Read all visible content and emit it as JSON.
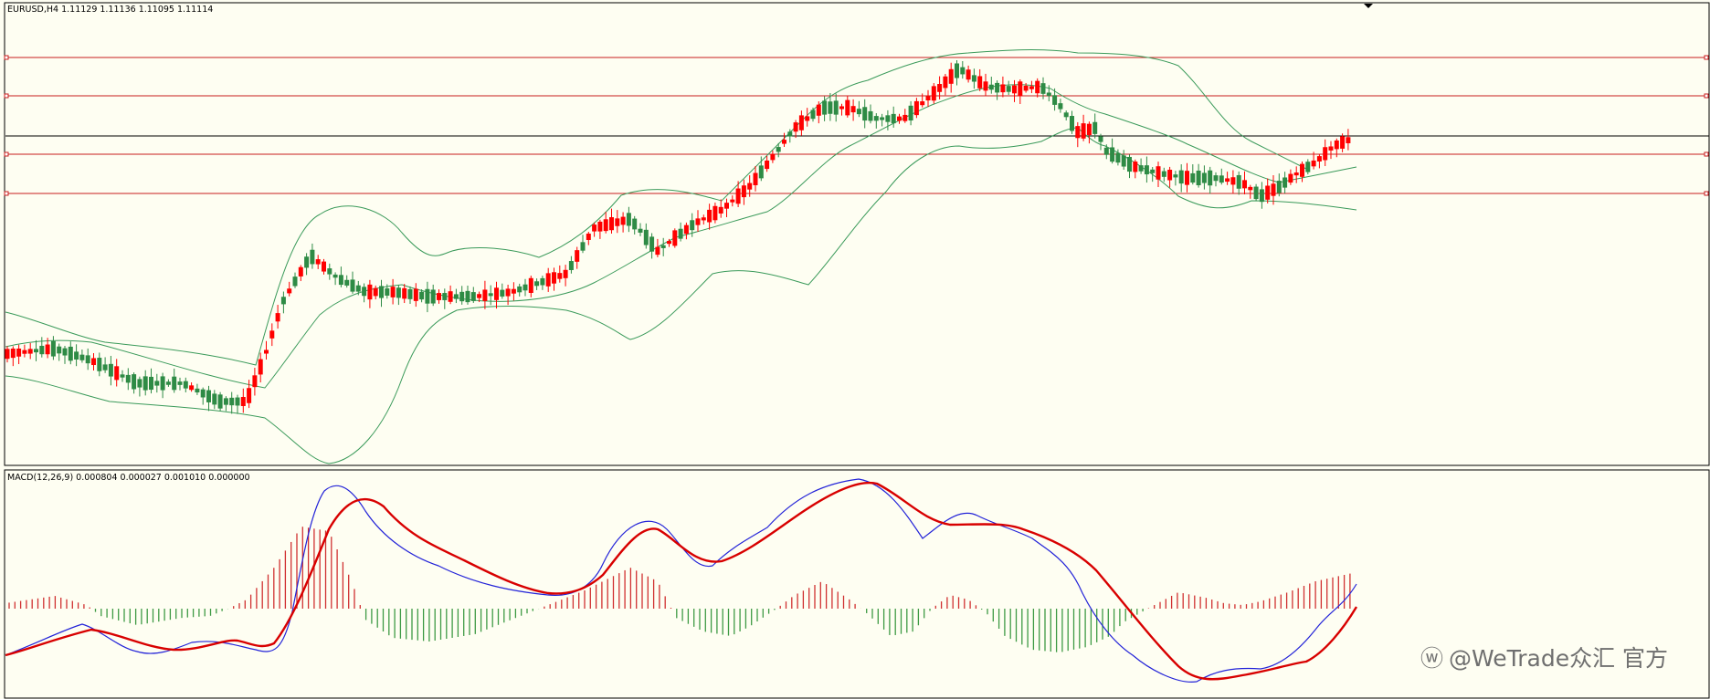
{
  "price_panel": {
    "header": "EURUSD,H4  1.11129 1.11136 1.11095 1.11114"
  },
  "macd_panel": {
    "header": "MACD(12,26,9) 0.000804 0.000027 0.001010 0.000000"
  },
  "watermark": "@WeTrade众汇 官方",
  "colors": {
    "background": "#fefef2",
    "bull_candle": "#ff0000",
    "bear_candle": "#2e8b45",
    "bollinger": "#3a9a5a",
    "level_line": "#c81e1e",
    "current_price_line": "#000000",
    "macd_line": "#2323d8",
    "signal_line": "#d80000",
    "hist_positive": "#d03030",
    "hist_negative": "#3e9a44"
  },
  "chart_data": [
    {
      "type": "candlestick",
      "symbol": "EURUSD",
      "timeframe": "H4",
      "last_bar": {
        "open": 1.11129,
        "high": 1.11136,
        "low": 1.11095,
        "close": 1.11114
      },
      "overlays": [
        "Bollinger Bands"
      ],
      "horizontal_levels": 4,
      "current_price_line": true,
      "grid": false
    },
    {
      "type": "line",
      "indicator": "MACD",
      "params": [
        12,
        26,
        9
      ],
      "values": [
        0.000804,
        2.7e-05,
        0.00101,
        0.0
      ],
      "series": [
        "macd",
        "signal",
        "histogram"
      ],
      "grid": false
    }
  ]
}
